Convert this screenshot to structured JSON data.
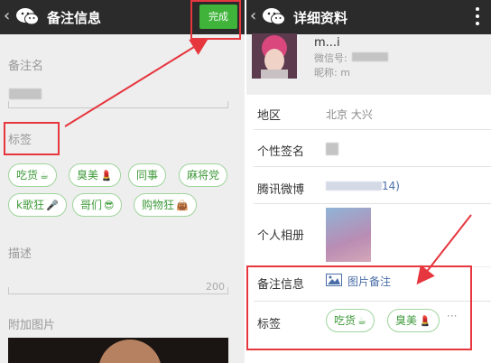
{
  "left": {
    "title": "备注信息",
    "done_label": "完成",
    "remark_name_label": "备注名",
    "tags_label": "标签",
    "tags": [
      {
        "text": "吃货",
        "emoji": "☕"
      },
      {
        "text": "臭美",
        "emoji": "💄"
      },
      {
        "text": "同事",
        "emoji": ""
      },
      {
        "text": "麻将党",
        "emoji": ""
      },
      {
        "text": "k歌狂",
        "emoji": "🎤"
      },
      {
        "text": "哥们",
        "emoji": "😎"
      },
      {
        "text": "购物狂",
        "emoji": "👜"
      }
    ],
    "description_label": "描述",
    "description_count": "200",
    "attach_photo_label": "附加图片"
  },
  "right": {
    "title": "详细资料",
    "profile": {
      "name_partial": "m...i",
      "wechat_id_label": "微信号:",
      "nickname_label": "昵称: m"
    },
    "rows": {
      "region_label": "地区",
      "region_value": "北京  大兴",
      "signature_label": "个性签名",
      "weibo_label": "腾讯微博",
      "weibo_value": "14)",
      "album_label": "个人相册",
      "remark_label": "备注信息",
      "remark_value": "图片备注",
      "tags_label": "标签"
    },
    "tags": [
      {
        "text": "吃货",
        "emoji": "☕"
      },
      {
        "text": "臭美",
        "emoji": "💄"
      }
    ],
    "more": "···"
  },
  "colors": {
    "accent_green": "#3fb33a",
    "tag_border": "#9fd59b",
    "highlight_red": "#e6363e",
    "titlebar": "#2b2b2b"
  },
  "icons": [
    "back-icon",
    "wechat-logo-icon",
    "more-vert-icon",
    "picture-icon",
    "emoji-icon"
  ]
}
